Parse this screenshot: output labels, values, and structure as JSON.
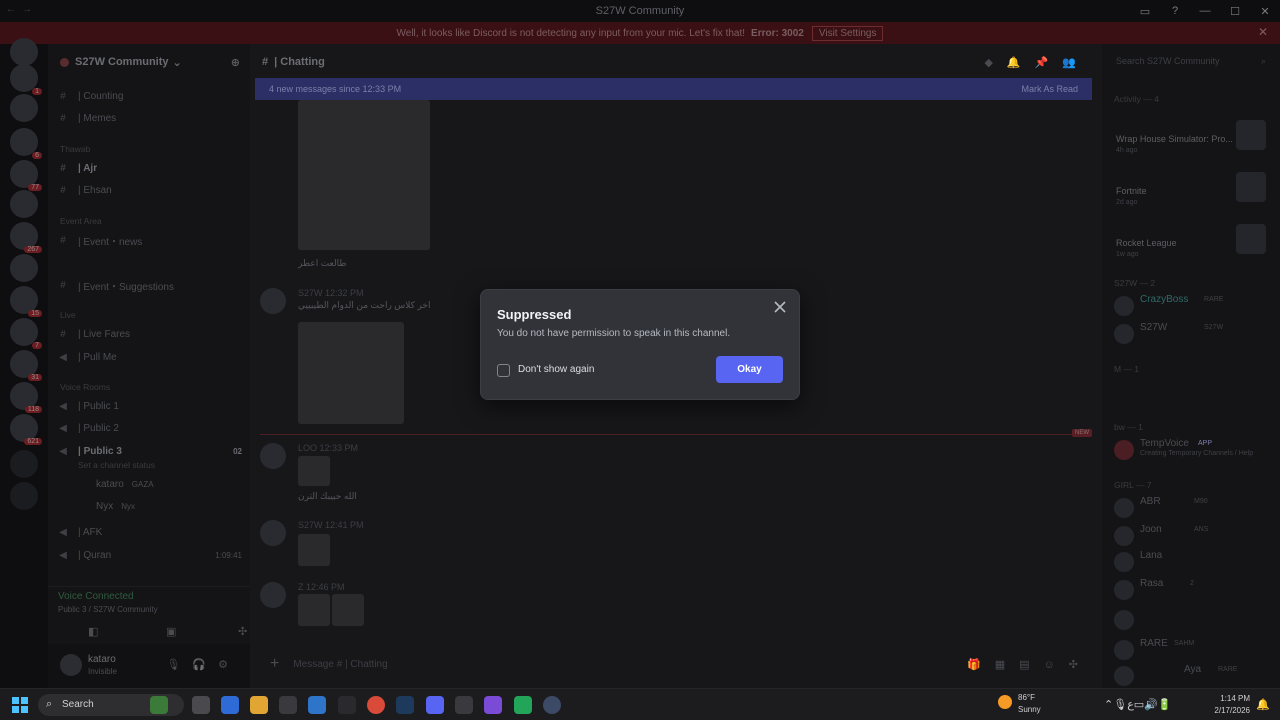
{
  "window": {
    "title": "S27W Community",
    "controls": [
      "—",
      "☐",
      "✕"
    ]
  },
  "banner": {
    "message": "Well, it looks like Discord is not detecting any input from your mic. Let's fix that!",
    "error": "Error: 3002",
    "button": "Visit Settings"
  },
  "server": {
    "name": "S27W Community"
  },
  "channels": [
    {
      "name": "| Counting"
    },
    {
      "name": "| Memes"
    },
    {
      "name": "| Ajr"
    },
    {
      "name": "| Ehsan"
    },
    {
      "name": "| Event・news"
    },
    {
      "name": "| Event・Suggestions"
    },
    {
      "name": "| Live Fares"
    },
    {
      "name": "| Pull Me"
    },
    {
      "name": "| Public 1"
    },
    {
      "name": "| Public 2"
    },
    {
      "name": "| Public 3"
    },
    {
      "name": "| AFK"
    },
    {
      "name": "| Quran"
    }
  ],
  "categories": {
    "thawab": "Thawab",
    "event": "Event Area",
    "live": "Live",
    "voice": "Voice Rooms"
  },
  "voice_sub": {
    "set_status": "Set a channel status",
    "user1": "kataro",
    "user1_tag": "GAZA",
    "user2": "Nyx",
    "user2_tag": "Nyx",
    "count": "02",
    "quran_time": "1:09:41"
  },
  "voice_connected": {
    "status": "Voice Connected",
    "location": "Public 3 / S27W Community"
  },
  "user": {
    "name": "kataro",
    "status": "Invisible"
  },
  "chat": {
    "channel": "| Chatting",
    "new_messages": "4 new messages since 12:33 PM",
    "mark_read": "Mark As Read",
    "composer_placeholder": "Message # | Chatting",
    "new_tag": "NEW",
    "messages": [
      {
        "name": "S27W",
        "time": "12:32 PM",
        "text": "اخر كلاس راحت من الدوام الطيبييي"
      },
      {
        "name": "LOO",
        "time": "12:33 PM",
        "text": "الله حبيبك الترن"
      },
      {
        "name": "S27W",
        "time": "12:41 PM",
        "text": ""
      },
      {
        "name": "Z",
        "time": "12:46 PM",
        "text": ""
      }
    ],
    "caption1": "طالعت اعطر"
  },
  "members_panel": {
    "search_placeholder": "Search S27W Community",
    "activity_header": "Activity — 4",
    "activities": [
      {
        "game": "Wrap House Simulator: Pro...",
        "ago": "4h ago"
      },
      {
        "game": "Fortnite",
        "ago": "2d ago"
      },
      {
        "game": "Rocket League",
        "ago": "1w ago"
      }
    ],
    "s27w_header": "S27W — 2",
    "members": [
      {
        "name": "CrazyBoss",
        "tag": "RARE"
      },
      {
        "name": "S27W",
        "tag": "S27W"
      },
      {
        "name": "TempVoice",
        "tag": "APP"
      },
      {
        "name": "ABR",
        "tag": "M90"
      },
      {
        "name": "Joon",
        "tag": "ANS"
      },
      {
        "name": "Lana",
        "tag": ""
      },
      {
        "name": "Rasa",
        "tag": "2"
      },
      {
        "name": "RARE",
        "tag": "SAHM"
      },
      {
        "name": "Aya",
        "tag": "RARE"
      }
    ],
    "m_header": "M — 1",
    "bw_header": "bw — 1",
    "girl_header": "GIRL — 7",
    "tempvoice_sub": "Creating Temporary Channels / Help"
  },
  "modal": {
    "title": "Suppressed",
    "description": "You do not have permission to speak in this channel.",
    "checkbox_label": "Don't show again",
    "button": "Okay"
  },
  "taskbar": {
    "search": "Search",
    "weather_temp": "86°F",
    "weather_cond": "Sunny",
    "time": "1:14 PM",
    "date": "2/17/2026"
  },
  "colors": {
    "accent": "#5865f2",
    "banner": "#3b1014",
    "modal_bg": "#323339"
  }
}
